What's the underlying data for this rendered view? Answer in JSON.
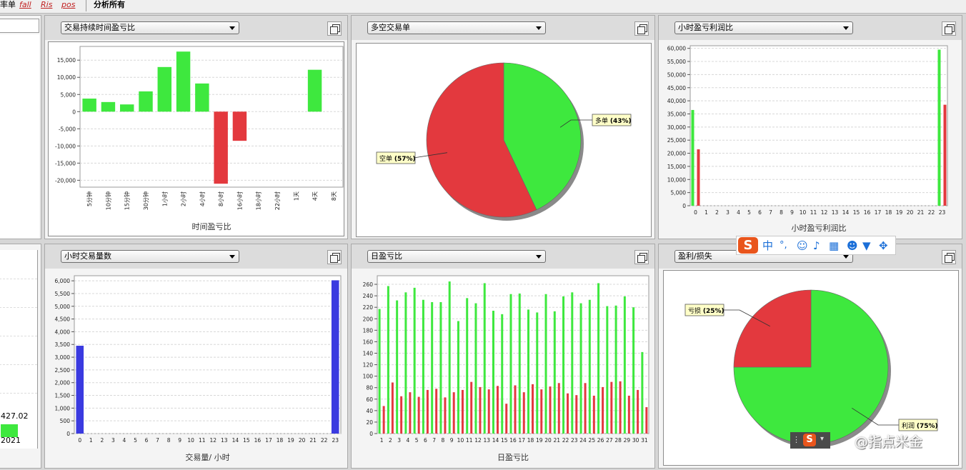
{
  "toolbar": {
    "items": [
      "率单",
      "fall",
      "Ris",
      "pos",
      "分析所有"
    ]
  },
  "colors": {
    "green": "#3ee83e",
    "red": "#e3393e",
    "blue": "#3a3ae0",
    "grid": "#d8d8d8"
  },
  "left_stub": {
    "value_text": "427.02",
    "year_text": "2021"
  },
  "panels": [
    {
      "id": "time-duration",
      "select_value": "交易持续时间盈亏比",
      "icon": "maximize-icon",
      "chart_data": {
        "type": "bar",
        "xlabel": "时间盈亏比",
        "categories": [
          "5分钟",
          "10分钟",
          "15分钟",
          "30分钟",
          "1小时",
          "2小时",
          "4小时",
          "8小时",
          "16小时",
          "18小时",
          "22小时",
          "1天",
          "4天",
          "8天"
        ],
        "values": [
          3800,
          2800,
          2100,
          5900,
          13000,
          17500,
          8200,
          -21000,
          -8500,
          0,
          0,
          0,
          12200,
          0
        ],
        "ylim": [
          -22000,
          19000
        ],
        "yticks": [
          15000,
          10000,
          5000,
          0,
          -5000,
          -10000,
          -15000,
          -20000
        ],
        "ytick_labels": [
          "15,000",
          "10,000",
          "5,000",
          "0",
          "-5,000",
          "-10,000",
          "-15,000",
          "-20,000"
        ]
      }
    },
    {
      "id": "long-short",
      "select_value": "多空交易单",
      "icon": "maximize-icon",
      "chart_data": {
        "type": "pie",
        "slices": [
          {
            "label": "多单",
            "pct_text": "(43%)",
            "value": 43,
            "color": "#3ee83e"
          },
          {
            "label": "空单",
            "pct_text": "(57%)",
            "value": 57,
            "color": "#e3393e"
          }
        ]
      }
    },
    {
      "id": "hourly-profit",
      "select_value": "小时盈亏利润比",
      "icon": "maximize-icon",
      "chart_data": {
        "type": "bar",
        "xlabel": "小时盈亏利润比",
        "categories": [
          "0",
          "1",
          "2",
          "3",
          "4",
          "5",
          "6",
          "7",
          "8",
          "9",
          "10",
          "11",
          "12",
          "13",
          "14",
          "15",
          "16",
          "17",
          "18",
          "19",
          "20",
          "21",
          "22",
          "23"
        ],
        "series": [
          {
            "color": "#3ee83e",
            "values": [
              36500,
              0,
              0,
              0,
              0,
              0,
              0,
              0,
              0,
              0,
              0,
              0,
              0,
              0,
              0,
              0,
              0,
              0,
              0,
              0,
              0,
              0,
              0,
              59500
            ]
          },
          {
            "color": "#e3393e",
            "values": [
              21500,
              0,
              0,
              0,
              0,
              0,
              0,
              0,
              0,
              0,
              0,
              0,
              0,
              0,
              0,
              0,
              0,
              0,
              0,
              0,
              0,
              0,
              0,
              38500
            ]
          }
        ],
        "ylim": [
          0,
          61000
        ],
        "yticks": [
          0,
          5000,
          10000,
          15000,
          20000,
          25000,
          30000,
          35000,
          40000,
          45000,
          50000,
          55000,
          60000
        ],
        "ytick_labels": [
          "0",
          "5,000",
          "10,000",
          "15,000",
          "20,000",
          "25,000",
          "30,000",
          "35,000",
          "40,000",
          "45,000",
          "50,000",
          "55,000",
          "60,000"
        ]
      }
    },
    {
      "id": "hourly-volume",
      "select_value": "小时交易量数",
      "icon": "maximize-icon",
      "chart_data": {
        "type": "bar",
        "xlabel": "交易量/ 小时",
        "categories": [
          "0",
          "1",
          "2",
          "3",
          "4",
          "5",
          "6",
          "7",
          "8",
          "9",
          "10",
          "11",
          "12",
          "13",
          "14",
          "15",
          "16",
          "17",
          "18",
          "19",
          "20",
          "21",
          "22",
          "23"
        ],
        "values": [
          3450,
          0,
          0,
          0,
          0,
          0,
          0,
          0,
          0,
          0,
          0,
          0,
          0,
          0,
          0,
          0,
          0,
          0,
          0,
          0,
          0,
          0,
          0,
          6020
        ],
        "ylim": [
          0,
          6200
        ],
        "yticks": [
          0,
          500,
          1000,
          1500,
          2000,
          2500,
          3000,
          3500,
          4000,
          4500,
          5000,
          5500,
          6000
        ],
        "ytick_labels": [
          "0",
          "500",
          "1,000",
          "1,500",
          "2,000",
          "2,500",
          "3,000",
          "3,500",
          "4,000",
          "4,500",
          "5,000",
          "5,500",
          "6,000"
        ]
      }
    },
    {
      "id": "daily-profit",
      "select_value": "日盈亏比",
      "icon": "maximize-icon",
      "chart_data": {
        "type": "bar",
        "xlabel": "日盈亏比",
        "categories": [
          "1",
          "2",
          "3",
          "4",
          "5",
          "6",
          "7",
          "8",
          "9",
          "10",
          "11",
          "12",
          "13",
          "14",
          "15",
          "16",
          "17",
          "18",
          "19",
          "20",
          "21",
          "22",
          "23",
          "24",
          "25",
          "26",
          "27",
          "28",
          "29",
          "30",
          "31"
        ],
        "series": [
          {
            "color": "#3ee83e",
            "values": [
              217,
              257,
              232,
              246,
              254,
              233,
              229,
              229,
              265,
              196,
              236,
              227,
              262,
              214,
              208,
              243,
              244,
              216,
              211,
              243,
              213,
              239,
              246,
              227,
              233,
              262,
              222,
              223,
              239,
              220,
              142
            ]
          },
          {
            "color": "#e3393e",
            "values": [
              48,
              89,
              65,
              72,
              64,
              76,
              78,
              63,
              72,
              76,
              90,
              81,
              77,
              83,
              52,
              84,
              72,
              86,
              77,
              82,
              88,
              70,
              67,
              88,
              66,
              81,
              90,
              91,
              66,
              76,
              46
            ]
          }
        ],
        "ylim": [
          0,
          275
        ],
        "yticks": [
          0,
          20,
          40,
          60,
          80,
          100,
          120,
          140,
          160,
          180,
          200,
          220,
          240,
          260
        ],
        "ytick_labels": [
          "0",
          "20",
          "40",
          "60",
          "80",
          "100",
          "120",
          "140",
          "160",
          "180",
          "200",
          "220",
          "240",
          "260"
        ]
      }
    },
    {
      "id": "profit-loss",
      "select_value": "盈利/损失",
      "icon": "maximize-icon",
      "chart_data": {
        "type": "pie",
        "slices": [
          {
            "label": "利润",
            "pct_text": "(75%)",
            "value": 75,
            "color": "#3ee83e"
          },
          {
            "label": "亏损",
            "pct_text": "(25%)",
            "value": 25,
            "color": "#e3393e"
          }
        ]
      }
    }
  ],
  "ime_toolbar": {
    "logo": "S",
    "lang": "中",
    "punct": "°,"
  },
  "watermark": "@指点米金"
}
